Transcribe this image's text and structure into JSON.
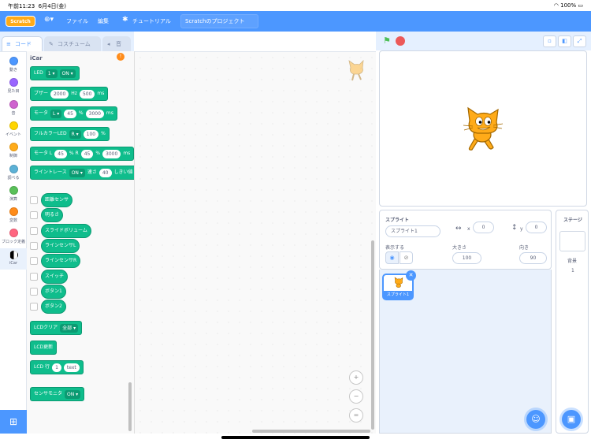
{
  "status": {
    "time": "午前11:23",
    "date": "6月4日(金)",
    "battery": "100%"
  },
  "menubar": {
    "logo": "Scratch",
    "file": "ファイル",
    "edit": "編集",
    "tutorial": "チュートリアル",
    "project": "Scratchのプロジェクト"
  },
  "tabs": {
    "code": "コード",
    "costume": "コスチューム",
    "sound": "音"
  },
  "categories": [
    {
      "label": "動き",
      "color": "#4c97ff"
    },
    {
      "label": "見た目",
      "color": "#9966ff"
    },
    {
      "label": "音",
      "color": "#cf63cf"
    },
    {
      "label": "イベント",
      "color": "#ffd500"
    },
    {
      "label": "制御",
      "color": "#ffab19"
    },
    {
      "label": "調べる",
      "color": "#5cb1d6"
    },
    {
      "label": "演算",
      "color": "#59c059"
    },
    {
      "label": "変数",
      "color": "#ff8c1a"
    },
    {
      "label": "ブロック定義",
      "color": "#ff6680"
    },
    {
      "label": "iCar",
      "color": "#000000"
    }
  ],
  "palette": {
    "title": "iCar",
    "warning": "!",
    "led": {
      "label": "LED",
      "num": "1",
      "state": "ON"
    },
    "buzzer": {
      "label": "ブザー",
      "hz": "2000",
      "hz_unit": "Hz",
      "ms": "500",
      "ms_unit": "ms"
    },
    "motor": {
      "label": "モータ",
      "side": "L",
      "pct": "45",
      "pct_unit": "%",
      "ms": "3000",
      "ms_unit": "ms"
    },
    "fullcolor": {
      "label": "フルカラーLED",
      "side": "R",
      "pct": "100",
      "pct_unit": "%"
    },
    "motor2": {
      "label": "モータ L",
      "l": "45",
      "mid": "% R",
      "r": "45",
      "pct_unit": "%",
      "ms": "3000",
      "ms_unit": "ms"
    },
    "linetrace": {
      "label": "ライントレース",
      "state": "ON",
      "speed_label": "速さ",
      "speed": "40",
      "thr": "しきい値"
    },
    "reporters": [
      "距離センサ",
      "明るさ",
      "スライドボリューム",
      "ラインセンサL",
      "ラインセンサR",
      "スイッチ",
      "ボタン1",
      "ボタン2"
    ],
    "lcdclear": {
      "label": "LCDクリア",
      "opt": "全部"
    },
    "lcdupdate": "LCD更新",
    "lcdrow": {
      "label": "LCD 行",
      "num": "1",
      "text": "text"
    },
    "sensormonitor": {
      "label": "センサモニタ",
      "state": "ON"
    }
  },
  "zoom": {
    "in": "+",
    "out": "−",
    "reset": "="
  },
  "sprite": {
    "title": "スプライト",
    "name": "スプライト1",
    "x_label": "x",
    "x": "0",
    "y_label": "y",
    "y": "0",
    "show_label": "表示する",
    "size_label": "大きさ",
    "size": "100",
    "dir_label": "向き",
    "dir": "90",
    "tile_name": "スプライト1"
  },
  "stage": {
    "title": "ステージ",
    "bg_label": "背景",
    "bg_count": "1"
  }
}
